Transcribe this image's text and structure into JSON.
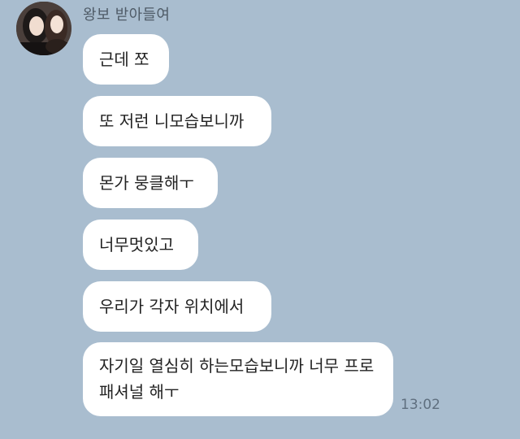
{
  "chat": {
    "sender_name": "왕보 받아들여",
    "messages": [
      {
        "text": "근데 쪼"
      },
      {
        "text": "또 저런 니모습보니까"
      },
      {
        "text": "몬가 뭉클해ㅜ"
      },
      {
        "text": "너무멋있고"
      },
      {
        "text": "우리가 각자 위치에서"
      },
      {
        "text": "자기일 열심히 하는모습보니까 너무 프로패셔널 해ㅜ"
      }
    ],
    "timestamp": "13:02"
  },
  "colors": {
    "background": "#a9bdcf",
    "bubble": "#ffffff",
    "text": "#222222",
    "sender": "#4f5b67",
    "timestamp": "#5f6f7f"
  }
}
